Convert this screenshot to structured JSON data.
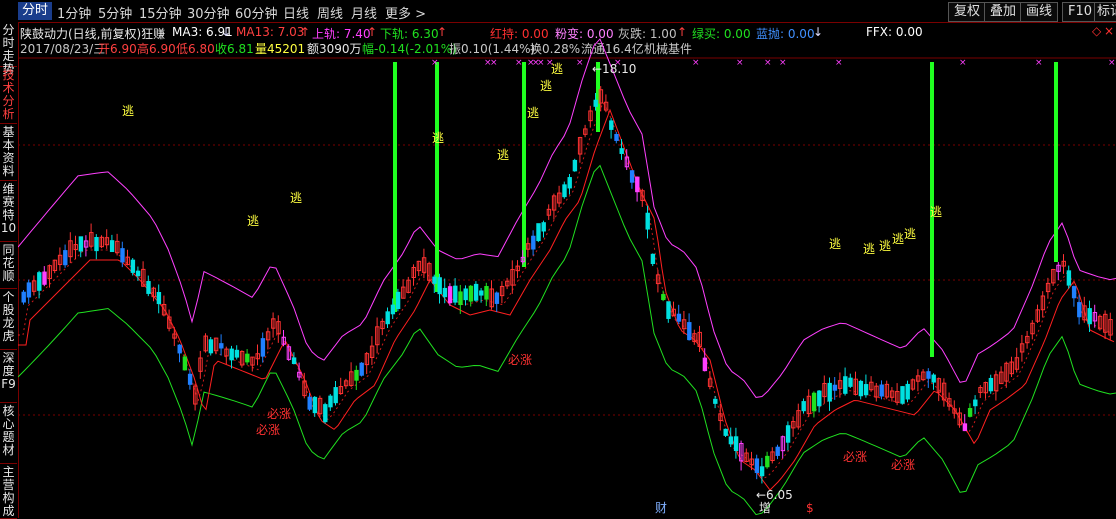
{
  "tabs": {
    "periods": [
      "分时",
      "1分钟",
      "5分钟",
      "15分钟",
      "30分钟",
      "60分钟",
      "日线",
      "周线",
      "月线",
      "更多 >"
    ],
    "active": "分时",
    "tools": [
      "复权",
      "叠加",
      "画线",
      "F10",
      "标记"
    ]
  },
  "side_tabs": [
    "分时走势",
    "技术分析",
    "基本资料",
    "维赛特10",
    "同花顺",
    "个股龙虎",
    "深度F9",
    "核心题材",
    "主营构成"
  ],
  "header": {
    "stock": "陕鼓动力(日线,前复权)狂赚",
    "ma3_label": "MA3: 6.91",
    "ma13_label": "MA13: 7.03",
    "upper_label": "上轨: 7.40",
    "lower_label": "下轨: 6.30",
    "red_label": "红持: 0.00",
    "pink_label": "粉变: 0.00",
    "gray_label": "灰跌: 1.00",
    "green_label": "绿买: 0.00",
    "blue_label": "蓝抛: 0.00",
    "ffx_label": "FFX: 0.00",
    "date": "2017/08/23/三",
    "open": "开6.90",
    "high": "高6.90",
    "low": "低6.80",
    "close": "收6.81",
    "volume": "量45201",
    "amount": "额3090万",
    "change": "幅-0.14(-2.01%)",
    "amp": "振0.10(1.44%)",
    "turnover": "换0.28%",
    "float": "流通16.4亿",
    "sector": "机械基件"
  },
  "annotations": {
    "high_mark": "18.10",
    "low_mark": "6.05",
    "escape": "逃",
    "must_rise": "必涨",
    "cai": "财",
    "zeng": "增",
    "dollar": "$",
    "cross": "×"
  },
  "colors": {
    "up": "#ff3232",
    "down": "#00e0e0",
    "ma3": "#ffffff",
    "ma13": "#ff2020",
    "upper": "#ff40ff",
    "lower": "#20e020",
    "gridline": "#7a0000",
    "signal_green": "#20ff20",
    "signal_pink": "#ff40ff",
    "signal_blue": "#2080ff",
    "escape_text": "#ffff40"
  }
}
